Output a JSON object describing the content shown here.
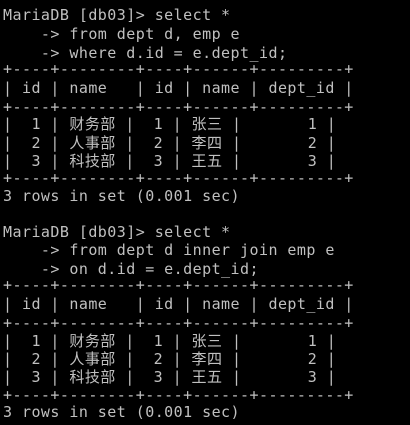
{
  "terminal": {
    "foreground": "#c0c0c0",
    "background": "#000000",
    "blocks": [
      {
        "lines": [
          "MariaDB [db03]> select *",
          "    -> from dept d, emp e",
          "    -> where d.id = e.dept_id;",
          "+----+--------+----+------+---------+",
          "| id | name   | id | name | dept_id |",
          "+----+--------+----+------+---------+",
          "|  1 | 财务部 |  1 | 张三 |       1 |",
          "|  2 | 人事部 |  2 | 李四 |       2 |",
          "|  3 | 科技部 |  3 | 王五 |       3 |",
          "+----+--------+----+------+---------+",
          "3 rows in set (0.001 sec)"
        ]
      },
      {
        "lines": [
          "MariaDB [db03]> select *",
          "    -> from dept d inner join emp e",
          "    -> on d.id = e.dept_id;",
          "+----+--------+----+------+---------+",
          "| id | name   | id | name | dept_id |",
          "+----+--------+----+------+---------+",
          "|  1 | 财务部 |  1 | 张三 |       1 |",
          "|  2 | 人事部 |  2 | 李四 |       2 |",
          "|  3 | 科技部 |  3 | 王五 |       3 |",
          "+----+--------+----+------+---------+",
          "3 rows in set (0.001 sec)"
        ]
      }
    ]
  }
}
